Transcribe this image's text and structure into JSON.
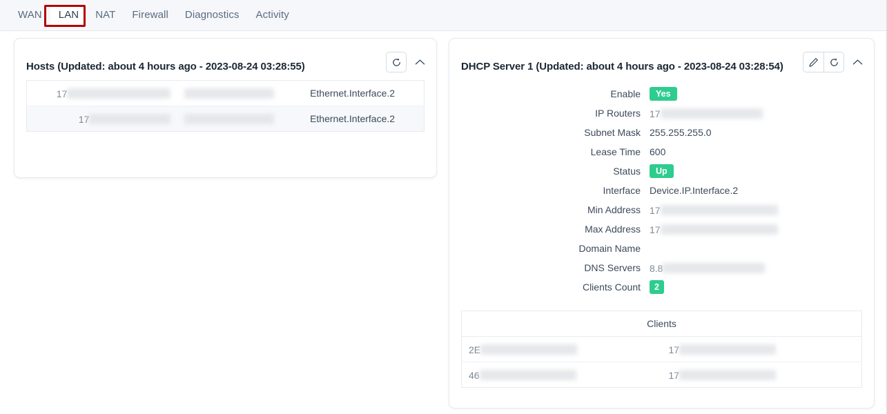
{
  "tabs": [
    {
      "label": "WAN",
      "active": false
    },
    {
      "label": "LAN",
      "active": true
    },
    {
      "label": "NAT",
      "active": false
    },
    {
      "label": "Firewall",
      "active": false
    },
    {
      "label": "Diagnostics",
      "active": false
    },
    {
      "label": "Activity",
      "active": false
    }
  ],
  "annotation": {
    "color": "#b00000",
    "target": "LAN"
  },
  "hosts_card": {
    "title": "Hosts (Updated: about 4 hours ago - 2023-08-24 03:28:55)",
    "refresh_icon": "refresh-icon",
    "collapse_icon": "chevron-up-icon",
    "rows": [
      {
        "ip_prefix": "17",
        "ip_redacted": true,
        "name_redacted": true,
        "interface": "Ethernet.Interface.2"
      },
      {
        "ip_prefix": "17",
        "ip_redacted": true,
        "name_redacted": true,
        "interface": "Ethernet.Interface.2"
      }
    ]
  },
  "dhcp_card": {
    "title": "DHCP Server 1 (Updated: about 4 hours ago - 2023-08-24 03:28:54)",
    "edit_icon": "pencil-icon",
    "refresh_icon": "refresh-icon",
    "collapse_icon": "chevron-up-icon",
    "details": [
      {
        "label": "Enable",
        "value": "Yes",
        "type": "badge"
      },
      {
        "label": "IP Routers",
        "value": "17",
        "type": "redacted"
      },
      {
        "label": "Subnet Mask",
        "value": "255.255.255.0",
        "type": "text"
      },
      {
        "label": "Lease Time",
        "value": "600",
        "type": "text"
      },
      {
        "label": "Status",
        "value": "Up",
        "type": "badge"
      },
      {
        "label": "Interface",
        "value": "Device.IP.Interface.2",
        "type": "text"
      },
      {
        "label": "Min Address",
        "value": "17",
        "type": "redacted"
      },
      {
        "label": "Max Address",
        "value": "17",
        "type": "redacted"
      },
      {
        "label": "Domain Name",
        "value": "",
        "type": "text"
      },
      {
        "label": "DNS Servers",
        "value": "8.8",
        "type": "redacted"
      },
      {
        "label": "Clients Count",
        "value": "2",
        "type": "badge"
      }
    ],
    "clients_table": {
      "header": "Clients",
      "rows": [
        {
          "mac_prefix": "2E",
          "ip_prefix": "17"
        },
        {
          "mac_prefix": "46",
          "ip_prefix": "17"
        }
      ]
    }
  },
  "colors": {
    "badge_green": "#2ecc8f",
    "annotation_red": "#b00000",
    "tabbar_bg": "#f5f7fa",
    "row_alt_bg": "#f6f8fb"
  }
}
